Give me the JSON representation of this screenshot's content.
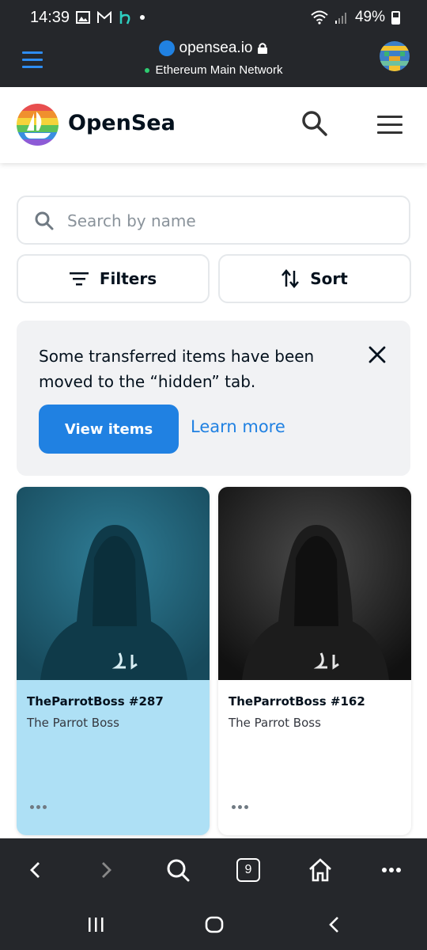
{
  "status_bar": {
    "time": "14:39",
    "battery": "49%",
    "icons": [
      "gallery-icon",
      "gmail-icon",
      "app-icon",
      "dot-icon",
      "wifi-icon",
      "signal-icon",
      "battery-icon"
    ]
  },
  "browser": {
    "domain": "opensea.io",
    "network": "Ethereum Main Network",
    "accent_color": "#2e8cf0"
  },
  "header": {
    "title": "OpenSea"
  },
  "search": {
    "placeholder": "Search by name",
    "value": ""
  },
  "controls": {
    "filters_label": "Filters",
    "sort_label": "Sort"
  },
  "notice": {
    "text": "Some transferred items have been moved to the “hidden” tab.",
    "view_items_label": "View items",
    "learn_more_label": "Learn more"
  },
  "items": [
    {
      "title": "TheParrotBoss #287",
      "collection": "The Parrot Boss",
      "bg_color": "#aee0f5",
      "image_tone": "#1d5a6e"
    },
    {
      "title": "TheParrotBoss #162",
      "collection": "The Parrot Boss",
      "bg_color": "#ffffff",
      "image_tone": "#1a1a1a"
    }
  ],
  "toolbar": {
    "tab_count": "9"
  },
  "colors": {
    "brand": "#2081e2",
    "dark_bar": "#25272b"
  }
}
